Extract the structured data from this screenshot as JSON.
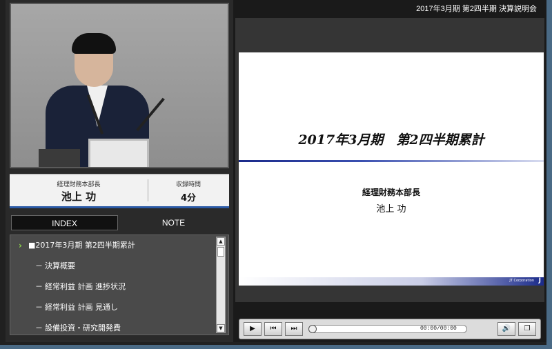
{
  "header": {
    "title": "2017年3月期 第2四半期 決算説明会"
  },
  "speaker": {
    "role": "経理財務本部長",
    "name": "池上 功",
    "duration_label": "収録時間",
    "duration_value": "4分"
  },
  "tabs": {
    "index": "INDEX",
    "note": "NOTE"
  },
  "index_items": [
    {
      "label": "■2017年3月期 第2四半期累計",
      "active": true
    },
    {
      "label": "決算概要"
    },
    {
      "label": "経常利益 計画 進捗状況"
    },
    {
      "label": "経常利益 計画 見通し"
    },
    {
      "label": "設備投資・研究開発費"
    }
  ],
  "index_dash": "－",
  "slide": {
    "title": "2017年3月期　第2四半期累計",
    "role": "経理財務本部長",
    "name": "池上 功",
    "corp": "JT Corporation",
    "logo": "J"
  },
  "player": {
    "time": "00:00/00:00",
    "play_icon": "play-icon",
    "prev_icon": "skip-back-icon",
    "next_icon": "skip-forward-icon",
    "volume_icon": "speaker-icon",
    "window_icon": "window-icon",
    "progress": 0
  }
}
